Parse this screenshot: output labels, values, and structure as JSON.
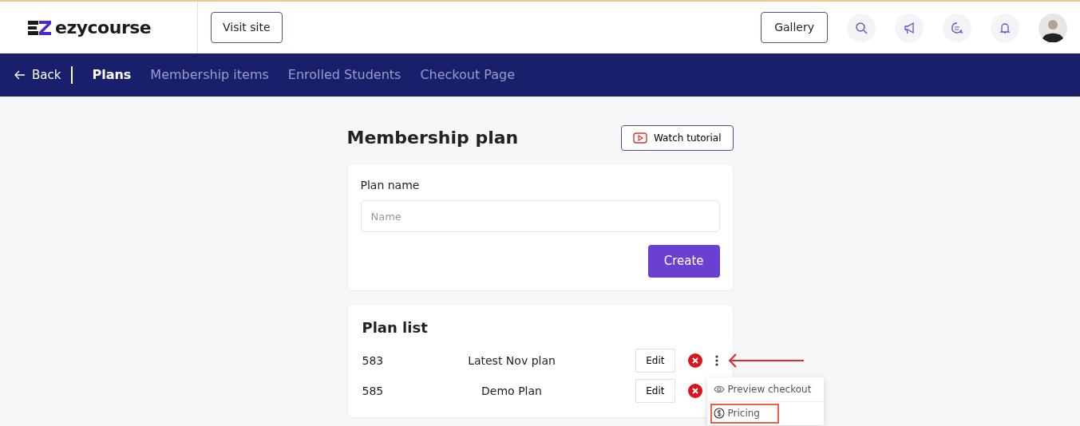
{
  "header": {
    "logo": "ezycourse",
    "visit_site": "Visit site",
    "gallery": "Gallery"
  },
  "nav": {
    "back": "Back",
    "tabs": [
      {
        "label": "Plans",
        "selected": true
      },
      {
        "label": "Membership items",
        "selected": false
      },
      {
        "label": "Enrolled Students",
        "selected": false
      },
      {
        "label": "Checkout Page",
        "selected": false
      }
    ]
  },
  "page_title": "Membership plan",
  "watch_tutorial": "Watch tutorial",
  "form": {
    "label": "Plan name",
    "placeholder": "Name",
    "create": "Create"
  },
  "plan_list": {
    "title": "Plan list",
    "rows": [
      {
        "id": "583",
        "name": "Latest Nov plan",
        "edit": "Edit",
        "menu_open": true
      },
      {
        "id": "585",
        "name": "Demo Plan",
        "edit": "Edit",
        "menu_open": false
      }
    ],
    "menu": [
      {
        "kind": "preview",
        "label": "Preview checkout",
        "highlighted": false
      },
      {
        "kind": "pricing",
        "label": "Pricing",
        "highlighted": true
      }
    ]
  }
}
